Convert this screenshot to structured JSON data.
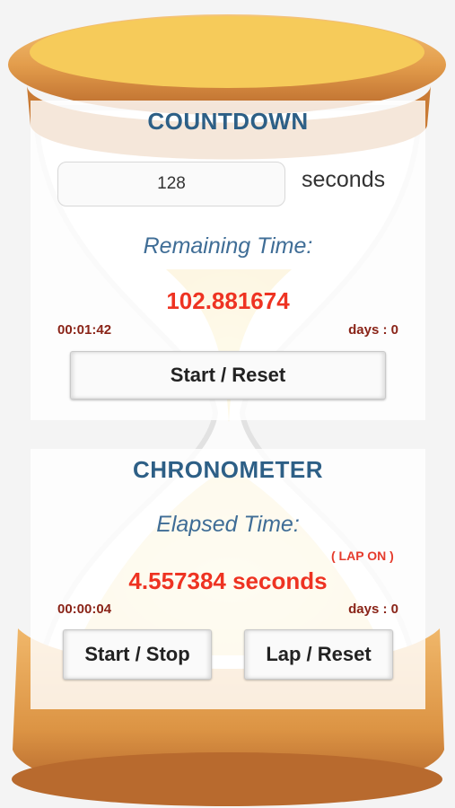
{
  "countdown": {
    "title": "COUNTDOWN",
    "seconds_value": "128",
    "seconds_label": "seconds",
    "remaining_label": "Remaining Time:",
    "remaining_value": "102.881674",
    "time_hms": "00:01:42",
    "days": "days : 0",
    "start_reset_label": "Start / Reset"
  },
  "chronometer": {
    "title": "CHRONOMETER",
    "elapsed_label": "Elapsed Time:",
    "lap_status": "( LAP ON )",
    "elapsed_value": "4.557384 seconds",
    "time_hms": "00:00:04",
    "days": "days : 0",
    "start_stop_label": "Start / Stop",
    "lap_reset_label": "Lap / Reset"
  },
  "colors": {
    "title": "#2d5f86",
    "value_red": "#ee3322",
    "dark_red": "#8a2418",
    "hourglass_wood": "#e6a456"
  }
}
